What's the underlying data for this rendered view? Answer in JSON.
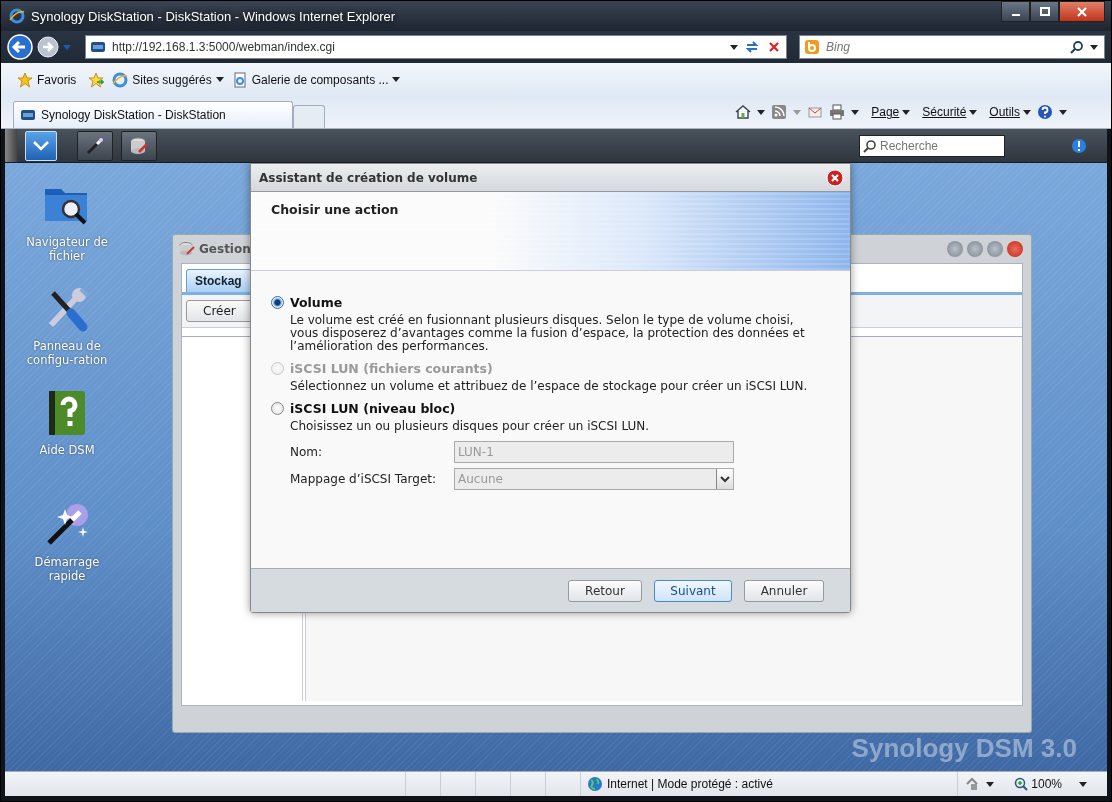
{
  "browser": {
    "title": "Synology DiskStation - DiskStation - Windows Internet Explorer",
    "address": "http://192.168.1.3:5000/webman/index.cgi",
    "search_placeholder": "Bing",
    "favorites": [
      {
        "label": "Favoris",
        "kind": "star"
      },
      {
        "label": "Sites suggérés",
        "kind": "ie"
      },
      {
        "label": "Galerie de composants ...",
        "kind": "page"
      }
    ],
    "tabs": [
      {
        "label": "Synology DiskStation - DiskStation",
        "selected": true
      }
    ],
    "commands": [
      "Page",
      "Sécurité",
      "Outils"
    ],
    "status": "Internet | Mode protégé : activé",
    "zoom": "100%"
  },
  "dsm": {
    "search_placeholder": "Recherche",
    "desktop_icons": [
      {
        "label": "Navigateur de fichier",
        "kind": "folder"
      },
      {
        "label": "Panneau de configu-ration",
        "kind": "tools"
      },
      {
        "label": "Aide DSM",
        "kind": "help"
      },
      {
        "label": "Démarrage rapide",
        "kind": "wand"
      }
    ],
    "brand": "Synology DSM 3.0",
    "storage_window": {
      "title": "Gestion",
      "tab": "Stockag",
      "button": "Créer"
    }
  },
  "wizard": {
    "title": "Assistant de création de volume",
    "heading": "Choisir une action",
    "options": [
      {
        "label": "Volume",
        "description": "Le volume est créé en fusionnant plusieurs disques. Selon le type de volume choisi, vous disposerez d’avantages comme la fusion d’espace, la protection des données et l’amélioration des performances.",
        "selected": true,
        "disabled": false
      },
      {
        "label": "iSCSI LUN (fichiers courants)",
        "description": "Sélectionnez un volume et attribuez de l’espace de stockage pour créer un iSCSI LUN.",
        "selected": false,
        "disabled": true
      },
      {
        "label": "iSCSI LUN (niveau bloc)",
        "description": "Choisissez un ou plusieurs disques pour créer un iSCSI LUN.",
        "selected": false,
        "disabled": false
      }
    ],
    "fields": [
      {
        "label": "Nom:",
        "value": "LUN-1",
        "kind": "text",
        "disabled": true
      },
      {
        "label": "Mappage d’iSCSI Target:",
        "value": "Aucune",
        "kind": "select",
        "disabled": true
      }
    ],
    "buttons": [
      {
        "label": "Retour",
        "primary": false
      },
      {
        "label": "Suivant",
        "primary": true
      },
      {
        "label": "Annuler",
        "primary": false
      }
    ]
  }
}
